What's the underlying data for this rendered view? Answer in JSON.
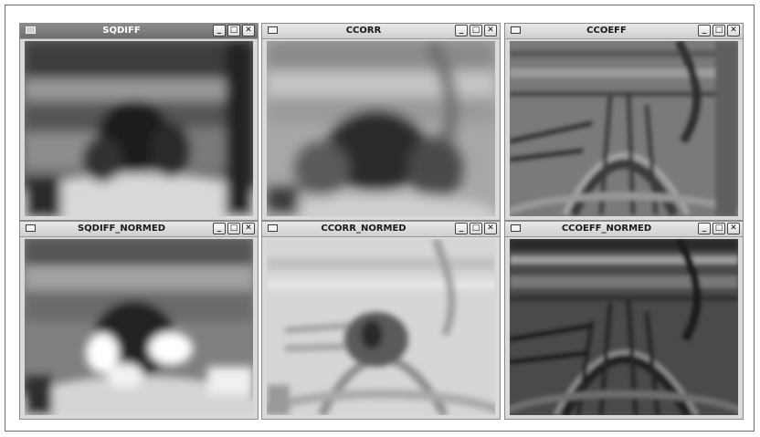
{
  "windows": [
    {
      "title": "SQDIFF",
      "active": true
    },
    {
      "title": "CCORR",
      "active": false
    },
    {
      "title": "CCOEFF",
      "active": false
    },
    {
      "title": "SQDIFF_NORMED",
      "active": false
    },
    {
      "title": "CCORR_NORMED",
      "active": false
    },
    {
      "title": "CCOEFF_NORMED",
      "active": false
    }
  ],
  "controls": {
    "minimize": "_",
    "maximize": "□",
    "close": "✕"
  }
}
